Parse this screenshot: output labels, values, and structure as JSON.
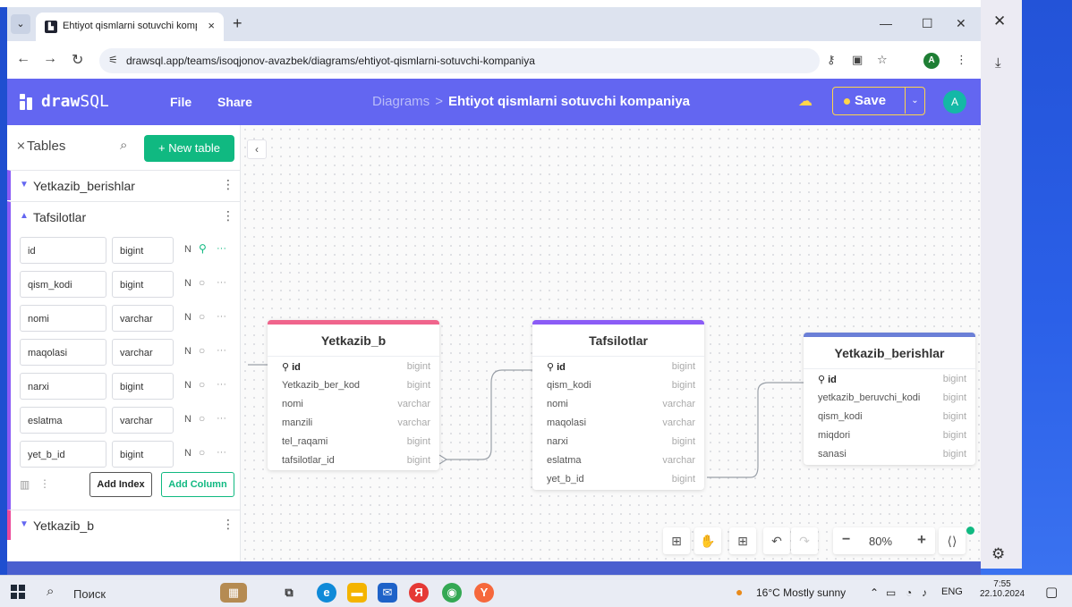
{
  "browser": {
    "tab_title": "Ehtiyot qismlarni sotuvchi komp",
    "tab_close": "×",
    "new_tab": "+",
    "url": "drawsql.app/teams/isoqjonov-avazbek/diagrams/ehtiyot-qismlarni-sotuvchi-kompaniya"
  },
  "header": {
    "logo_bold": "draw",
    "logo_light": "SQL",
    "menu_file": "File",
    "menu_share": "Share",
    "crumb_root": "Diagrams",
    "crumb_sep": ">",
    "crumb_current": "Ehtiyot qismlarni sotuvchi kompaniya",
    "save_label": "Save",
    "avatar": "A"
  },
  "sidebar": {
    "title": "Tables",
    "new_table": "+ New table",
    "groups": [
      {
        "name": "Yetkazib_berishlar"
      },
      {
        "name": "Tafsilotlar"
      },
      {
        "name": "Yetkazib_b"
      }
    ],
    "columns": [
      {
        "name": "id",
        "type": "bigint",
        "nullable": "N"
      },
      {
        "name": "qism_kodi",
        "type": "bigint",
        "nullable": "N"
      },
      {
        "name": "nomi",
        "type": "varchar",
        "nullable": "N"
      },
      {
        "name": "maqolasi",
        "type": "varchar",
        "nullable": "N"
      },
      {
        "name": "narxi",
        "type": "bigint",
        "nullable": "N"
      },
      {
        "name": "eslatma",
        "type": "varchar",
        "nullable": "N"
      },
      {
        "name": "yet_b_id",
        "type": "bigint",
        "nullable": "N"
      }
    ],
    "add_index": "Add Index",
    "add_column": "Add Column"
  },
  "tables": [
    {
      "title": "Yetkazib_b",
      "color": "#f0648c",
      "rows": [
        [
          "id",
          "bigint"
        ],
        [
          "Yetkazib_ber_kod",
          "bigint"
        ],
        [
          "nomi",
          "varchar"
        ],
        [
          "manzili",
          "varchar"
        ],
        [
          "tel_raqami",
          "bigint"
        ],
        [
          "tafsilotlar_id",
          "bigint"
        ]
      ]
    },
    {
      "title": "Tafsilotlar",
      "color": "#8b5cf6",
      "rows": [
        [
          "id",
          "bigint"
        ],
        [
          "qism_kodi",
          "bigint"
        ],
        [
          "nomi",
          "varchar"
        ],
        [
          "maqolasi",
          "varchar"
        ],
        [
          "narxi",
          "bigint"
        ],
        [
          "eslatma",
          "varchar"
        ],
        [
          "yet_b_id",
          "bigint"
        ]
      ]
    },
    {
      "title": "Yetkazib_berishlar",
      "color": "#6b7fd7",
      "rows": [
        [
          "id",
          "bigint"
        ],
        [
          "yetkazib_beruvchi_kodi",
          "bigint"
        ],
        [
          "qism_kodi",
          "bigint"
        ],
        [
          "miqdori",
          "bigint"
        ],
        [
          "sanasi",
          "bigint"
        ]
      ]
    }
  ],
  "zoom": {
    "value": "80%"
  },
  "taskbar": {
    "search_placeholder": "Поиск",
    "weather": "16°C Mostly sunny",
    "lang": "ENG",
    "time": "7:55",
    "date": "22.10.2024"
  }
}
